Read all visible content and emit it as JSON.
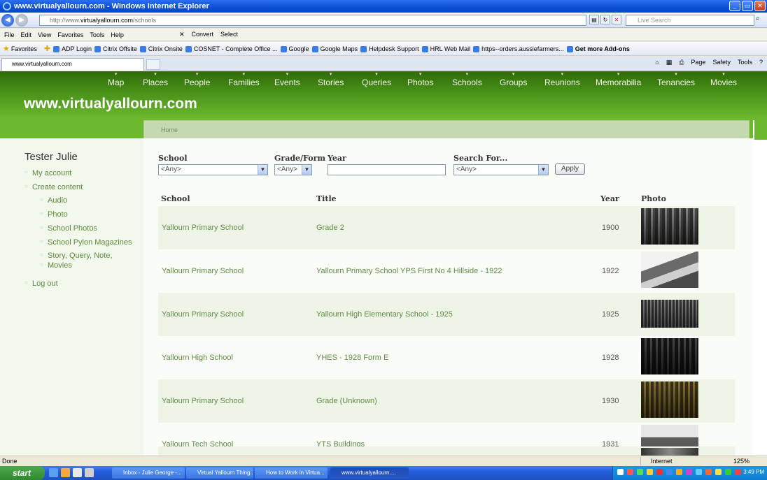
{
  "window": {
    "title": "www.virtualyallourn.com - Windows Internet Explorer",
    "url_prefix": "http://www.",
    "url_domain": "virtualyallourn.com",
    "url_path": "/schools",
    "search_placeholder": "Live Search"
  },
  "menu": {
    "items": [
      "File",
      "Edit",
      "View",
      "Favorites",
      "Tools",
      "Help"
    ],
    "convert_label": "Convert",
    "select_label": "Select"
  },
  "favorites": {
    "label": "Favorites",
    "items": [
      "ADP Login",
      "Citrix Offsite",
      "Citrix Onsite",
      "COSNET - Complete Office ...",
      "Google",
      "Google Maps",
      "Helpdesk Support",
      "HRL Web Mail",
      "https--orders.aussiefarmers...",
      "Get more Add-ons"
    ]
  },
  "tab": {
    "label": "www.virtualyallourn.com",
    "commands": [
      "Page",
      "Safety",
      "Tools"
    ]
  },
  "site": {
    "title": "www.virtualyallourn.com",
    "nav": [
      "Map",
      "Places",
      "People",
      "Families",
      "Events",
      "Stories",
      "Queries",
      "Photos",
      "Schools",
      "Groups",
      "Reunions",
      "Memorabilia",
      "Tenancies",
      "Movies"
    ],
    "breadcrumb": "Home"
  },
  "sidebar": {
    "user": "Tester Julie",
    "items": [
      "My account",
      "Create content",
      "Log out"
    ],
    "sub_items": [
      "Audio",
      "Photo",
      "School Photos",
      "School Pylon Magazines",
      "Story, Query, Note,",
      "Movies"
    ]
  },
  "filters": {
    "school_label": "School",
    "school_value": "<Any>",
    "grade_label": "Grade/Form",
    "grade_value": "<Any>",
    "year_label": "Year",
    "search_label": "Search For...",
    "search_value": "<Any>",
    "apply_label": "Apply"
  },
  "table": {
    "headers": [
      "School",
      "Title",
      "Year",
      "Photo"
    ],
    "rows": [
      {
        "school": "Yallourn Primary School",
        "title": "Grade 2",
        "year": "1900"
      },
      {
        "school": "Yallourn Primary School",
        "title": "Yallourn Primary School YPS First No 4 Hillside - 1922",
        "year": "1922"
      },
      {
        "school": "Yallourn Primary School",
        "title": "Yallourn High Elementary School - 1925",
        "year": "1925"
      },
      {
        "school": "Yallourn High School",
        "title": "YHES - 1928 Form E",
        "year": "1928"
      },
      {
        "school": "Yallourn Primary School",
        "title": "Grade (Unknown)",
        "year": "1930"
      },
      {
        "school": "Yallourn Tech School",
        "title": "YTS Buildings",
        "year": "1931"
      }
    ]
  },
  "status": {
    "text": "Done",
    "zone": "Internet",
    "zoom": "125%"
  },
  "taskbar": {
    "start": "start",
    "tasks": [
      "Inbox - Julie George -...",
      "Virtual Yallourn Thing...",
      "How to Work in Virtua...",
      "www.virtualyallourn...."
    ],
    "clock": "3:49 PM"
  },
  "colors": {
    "header_green": "#4f9a1c",
    "link_green": "#5f8c45",
    "row_shade": "#eef5e6",
    "xp_blue": "#245edb"
  }
}
